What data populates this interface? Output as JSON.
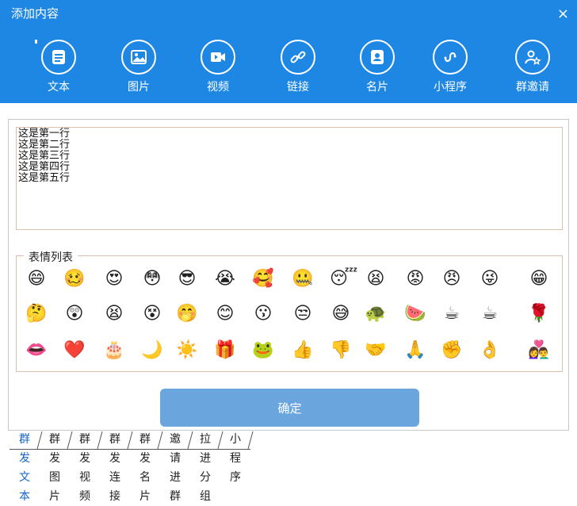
{
  "window": {
    "title": "添加内容",
    "close_icon": "×"
  },
  "toolbar": {
    "items": [
      {
        "label": "文本",
        "icon": "text-icon"
      },
      {
        "label": "图片",
        "icon": "image-icon"
      },
      {
        "label": "视频",
        "icon": "video-icon"
      },
      {
        "label": "链接",
        "icon": "link-icon"
      },
      {
        "label": "名片",
        "icon": "contact-card-icon"
      },
      {
        "label": "小程序",
        "icon": "mini-program-icon"
      },
      {
        "label": "群邀请",
        "icon": "group-invite-icon"
      }
    ]
  },
  "editor": {
    "lines": [
      "这是第一行",
      "这是第二行",
      "这是第三行",
      "这是第四行",
      "这是第五行"
    ]
  },
  "emoji_panel": {
    "legend": "表情列表",
    "rows": [
      [
        "😄",
        "🥴",
        "😍",
        "😳",
        "😎",
        "😭",
        "🥰",
        "🤐",
        "😴",
        "😫",
        "😡",
        "😠",
        "😜",
        "😁"
      ],
      [
        "🤔",
        "😲",
        "😫",
        "😵",
        "🤭",
        "😊",
        "😗",
        "😒",
        "😅",
        "🐢",
        "🍉",
        "☕",
        "☕",
        "🌹"
      ],
      [
        "👄",
        "❤️",
        "🎂",
        "🌙",
        "☀️",
        "🎁",
        "🐸",
        "👍",
        "👎",
        "🤝",
        "🙏",
        "✊",
        "👌",
        "👩‍❤️‍👨"
      ]
    ]
  },
  "confirm_button": "确定",
  "tabs": [
    {
      "label": "群发文本",
      "active": true
    },
    {
      "label": "群发图片",
      "active": false
    },
    {
      "label": "群发视频",
      "active": false
    },
    {
      "label": "群发连接",
      "active": false
    },
    {
      "label": "群发名片",
      "active": false
    },
    {
      "label": "邀请进群",
      "active": false
    },
    {
      "label": "拉进分组",
      "active": false
    },
    {
      "label": "小程序",
      "active": false
    }
  ],
  "colors": {
    "header": "#1e87e4",
    "button": "#6aa6dd",
    "active_tab": "#1565c8",
    "frame_border": "#d9bfae"
  }
}
